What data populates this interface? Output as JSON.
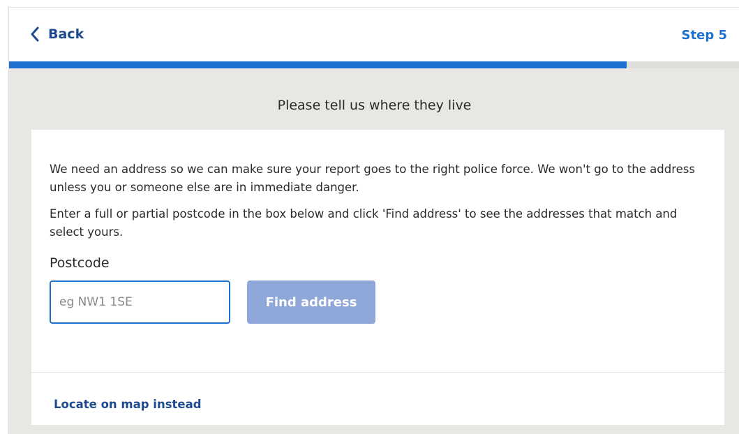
{
  "header": {
    "back_label": "Back",
    "back_icon": "chevron-left-icon",
    "step_label": "Step 5"
  },
  "progress": {
    "percent": 84.5,
    "fill_color": "#1d6fd0"
  },
  "page": {
    "heading": "Please tell us where they live"
  },
  "card": {
    "para1": "We need an address so we can make sure your report goes to the right police force. We won't go to the address unless you or someone else are in immediate danger.",
    "para2": "Enter a full or partial postcode in the box below and click 'Find address' to see the addresses that match and select yours.",
    "postcode_label": "Postcode",
    "postcode_value": "",
    "postcode_placeholder": "eg NW1 1SE",
    "find_button_label": "Find address",
    "map_link_label": "Locate on map instead"
  },
  "colors": {
    "accent": "#1d6fd0",
    "link": "#1d4a8f",
    "button_disabled": "#8fa6d8",
    "background": "#e8e7e4"
  }
}
